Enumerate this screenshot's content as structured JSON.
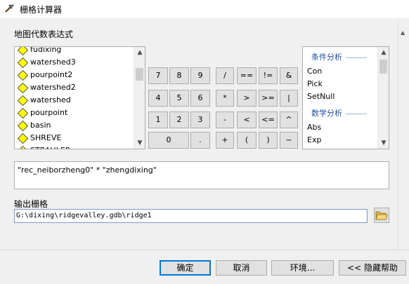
{
  "window": {
    "title": "栅格计算器"
  },
  "expression_section": {
    "label": "地图代数表达式"
  },
  "layers": [
    {
      "name": "fudixing"
    },
    {
      "name": "watershed3"
    },
    {
      "name": "pourpoint2"
    },
    {
      "name": "watershed2"
    },
    {
      "name": "watershed"
    },
    {
      "name": "pourpoint"
    },
    {
      "name": "basin"
    },
    {
      "name": "SHREVE"
    },
    {
      "name": "STRAHLER"
    }
  ],
  "calc_buttons": {
    "seven": "7",
    "eight": "8",
    "nine": "9",
    "divide": "/",
    "equal": "==",
    "not_equal": "!=",
    "and": "&",
    "four": "4",
    "five": "5",
    "six": "6",
    "multiply": "*",
    "greater": ">",
    "greater_equal": ">=",
    "or": "|",
    "one": "1",
    "two": "2",
    "three": "3",
    "minus": "-",
    "less": "<",
    "less_equal": "<=",
    "xor": "^",
    "zero": "0",
    "decimal": ".",
    "plus": "+",
    "open_paren": "(",
    "close_paren": ")",
    "not": "~"
  },
  "tools": {
    "conditional_header": "条件分析",
    "conditional_items": [
      "Con",
      "Pick",
      "SetNull"
    ],
    "math_header": "数学分析",
    "math_items": [
      "Abs",
      "Exp"
    ]
  },
  "expression": {
    "value": "\"rec_neiborzheng0\" * \"zhengdixing\""
  },
  "output": {
    "label": "输出栅格",
    "value": "G:\\dixing\\ridgevalley.gdb\\ridge1"
  },
  "dialog_buttons": {
    "ok": "确定",
    "cancel": "取消",
    "environments": "环境...",
    "hide_help": "<< 隐藏帮助"
  },
  "colors": {
    "layer_icon": "#ffff00",
    "tool_header": "#1f4e9c",
    "dialog_bg": "#f0f0f0",
    "default_button_border": "#0078d7"
  }
}
